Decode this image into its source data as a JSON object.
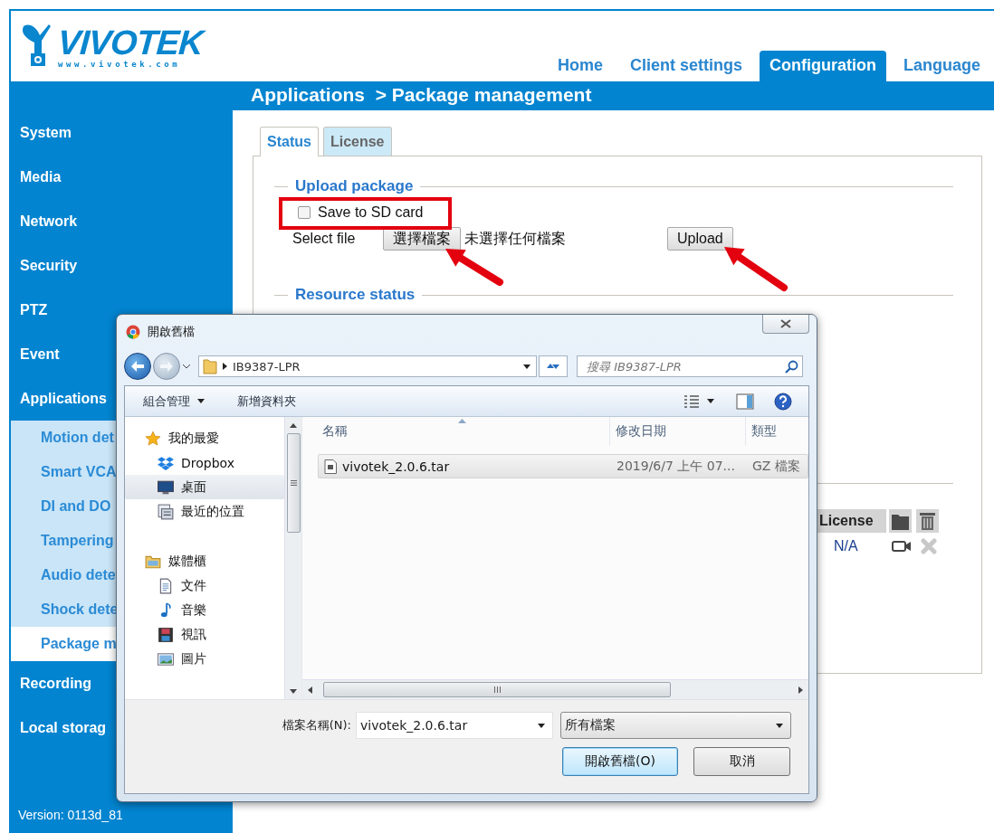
{
  "header": {
    "logo_text": "VIVOTEK",
    "logo_url": "www.vivotek.com"
  },
  "nav": [
    {
      "label": "Home",
      "selected": false
    },
    {
      "label": "Client settings",
      "selected": false
    },
    {
      "label": "Configuration",
      "selected": true
    },
    {
      "label": "Language",
      "selected": false
    }
  ],
  "breadcrumb": "Applications  > Package management",
  "sidebar": {
    "items": [
      {
        "label": "System",
        "kind": "section",
        "selected": false
      },
      {
        "label": "Media",
        "kind": "section",
        "selected": false
      },
      {
        "label": "Network",
        "kind": "section",
        "selected": false
      },
      {
        "label": "Security",
        "kind": "section",
        "selected": false
      },
      {
        "label": "PTZ",
        "kind": "section",
        "selected": false
      },
      {
        "label": "Event",
        "kind": "section",
        "selected": false
      },
      {
        "label": "Applications",
        "kind": "section",
        "selected": false
      },
      {
        "label": "Motion det",
        "kind": "sub",
        "selected": false
      },
      {
        "label": "Smart VCA",
        "kind": "sub",
        "selected": false
      },
      {
        "label": "DI and DO",
        "kind": "sub",
        "selected": false
      },
      {
        "label": "Tampering",
        "kind": "sub",
        "selected": false
      },
      {
        "label": "Audio dete",
        "kind": "sub",
        "selected": false
      },
      {
        "label": "Shock dete",
        "kind": "sub",
        "selected": false
      },
      {
        "label": "Package m",
        "kind": "sub",
        "selected": true
      },
      {
        "label": "Recording",
        "kind": "section",
        "selected": false
      },
      {
        "label": "Local storag",
        "kind": "section",
        "selected": false
      }
    ],
    "version": "Version: 0113d_81"
  },
  "tabs": [
    {
      "label": "Status",
      "selected": true
    },
    {
      "label": "License",
      "selected": false
    }
  ],
  "upload": {
    "legend": "Upload package",
    "save_to_sd": {
      "label": "Save to SD card",
      "checked": false
    },
    "select_label": "Select file",
    "choose_button": "選擇檔案",
    "no_file": "未選擇任何檔案",
    "upload_button": "Upload"
  },
  "resource": {
    "legend": "Resource status"
  },
  "packages_table": {
    "columns": [
      "License"
    ],
    "rows": [
      {
        "license": "N/A",
        "removable": false
      }
    ]
  },
  "dialog": {
    "title": "開啟舊檔",
    "path": "IB9387-LPR",
    "search": {
      "placeholder": "搜尋 IB9387-LPR"
    },
    "toolbar": {
      "organize": "組合管理",
      "new_folder": "新增資料夾"
    },
    "nav": [
      {
        "label": "我的最愛",
        "kind": "favorites",
        "selected": false,
        "children": [
          {
            "label": "Dropbox",
            "kind": "dropbox",
            "selected": false
          },
          {
            "label": "桌面",
            "kind": "desktop",
            "selected": true
          },
          {
            "label": "最近的位置",
            "kind": "recent",
            "selected": false
          }
        ]
      },
      {
        "label": "媒體櫃",
        "kind": "library",
        "selected": false,
        "children": [
          {
            "label": "文件",
            "kind": "documents",
            "selected": false
          },
          {
            "label": "音樂",
            "kind": "music",
            "selected": false
          },
          {
            "label": "視訊",
            "kind": "video",
            "selected": false
          },
          {
            "label": "圖片",
            "kind": "pictures",
            "selected": false
          }
        ]
      }
    ],
    "columns": [
      "名稱",
      "修改日期",
      "類型"
    ],
    "files": [
      {
        "name": "vivotek_2.0.6.tar",
        "modified": "2019/6/7 上午 07...",
        "type": "GZ 檔案",
        "selected": true
      }
    ],
    "filename_label": "檔案名稱(N):",
    "filename_value": "vivotek_2.0.6.tar",
    "filetype": "所有檔案",
    "open_button": "開啟舊檔(O)",
    "cancel_button": "取消"
  }
}
